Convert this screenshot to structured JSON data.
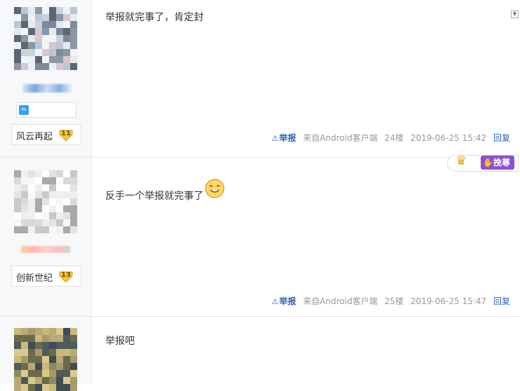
{
  "posts": [
    {
      "username_masked": "",
      "level_name": "风云再起",
      "level": "11",
      "content": "举报就完事了，肯定封",
      "report": "举报",
      "client": "来自Android客户端",
      "floor": "24楼",
      "time": "2019-06-25 15:42",
      "reply": "回复"
    },
    {
      "level_name": "创新世纪",
      "level": "13",
      "content": "反手一个举报就完事了",
      "report": "举报",
      "client": "来自Android客户端",
      "floor": "25楼",
      "time": "2019-06-25 15:47",
      "reply": "回复",
      "tag_label": "挽尊"
    },
    {
      "content": "举报吧"
    }
  ],
  "colors": {
    "link": "#2d64b3",
    "zun_purple": "#8f4fd6",
    "level_gold": "#f5c542"
  },
  "icons": {
    "warning": "warning-triangle-icon",
    "crown": "crown-icon",
    "emoji": "smiley-icon",
    "dropdown": "dropdown-arrow-icon"
  }
}
